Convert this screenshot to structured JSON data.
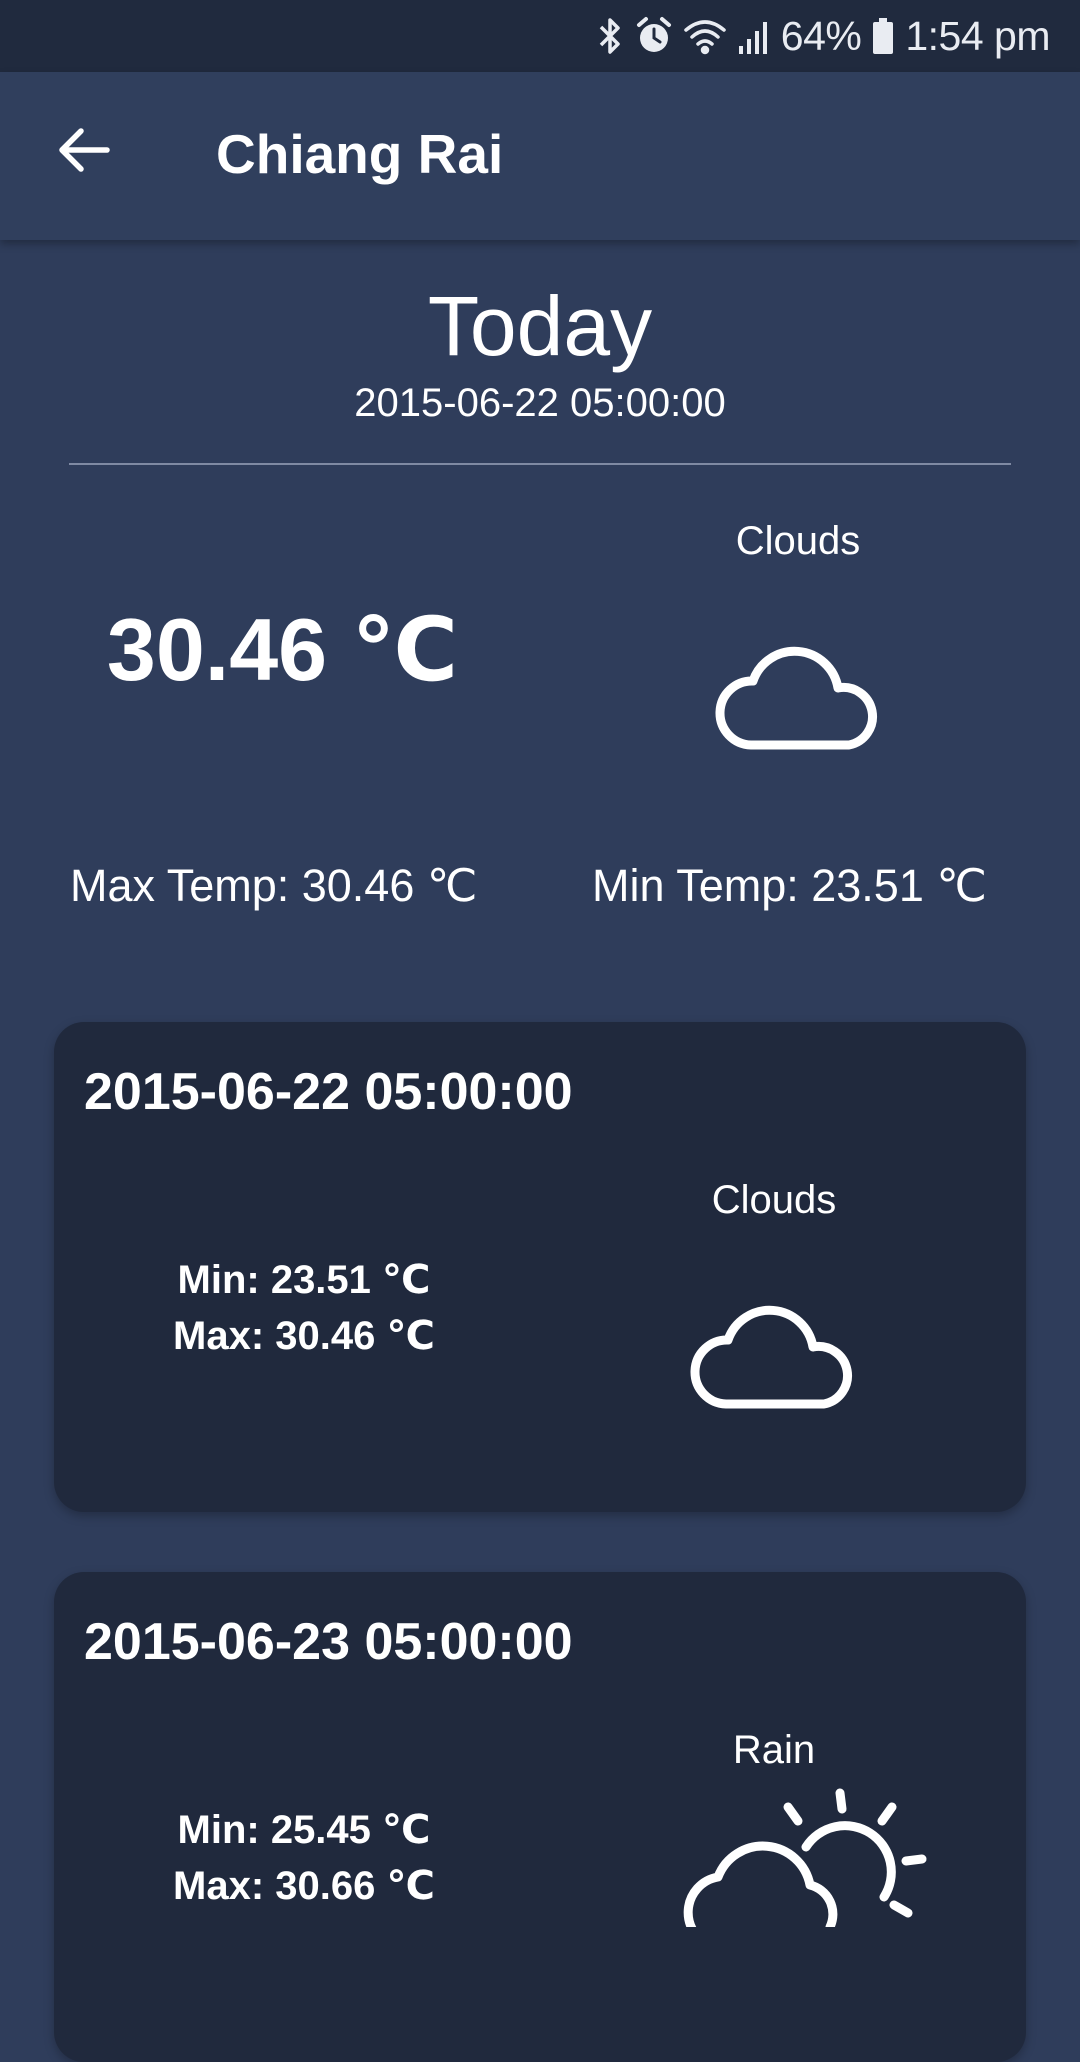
{
  "status_bar": {
    "battery": "64%",
    "time": "1:54 pm",
    "icons": [
      "bluetooth-icon",
      "alarm-icon",
      "wifi-icon",
      "signal-icon",
      "battery-icon"
    ]
  },
  "app_bar": {
    "title": "Chiang Rai",
    "back_icon": "arrow-back-icon"
  },
  "today": {
    "heading": "Today",
    "date": "2015-06-22 05:00:00",
    "temperature": "30.46 ℃",
    "condition": "Clouds",
    "condition_icon": "cloud-icon",
    "max_temp": "Max Temp: 30.46 ℃",
    "min_temp": "Min Temp: 23.51 ℃"
  },
  "forecast": [
    {
      "date": "2015-06-22 05:00:00",
      "condition": "Clouds",
      "icon": "cloud-icon",
      "min": "Min: 23.51 ℃",
      "max": "Max: 30.46 ℃"
    },
    {
      "date": "2015-06-23 05:00:00",
      "condition": "Rain",
      "icon": "sun-cloud-icon",
      "min": "Min: 25.45 ℃",
      "max": "Max: 30.66 ℃"
    }
  ],
  "colors": {
    "background": "#2f3d5b",
    "status_bar": "#202a3e",
    "card": "#20293d",
    "text": "#ffffff"
  }
}
